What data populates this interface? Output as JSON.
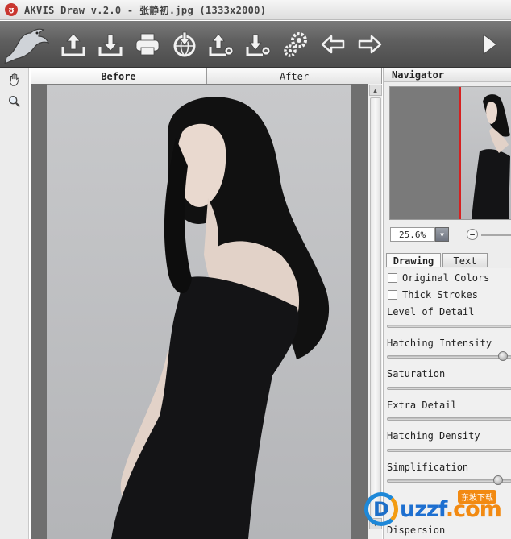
{
  "window": {
    "title": "AKVIS Draw v.2.0 - 张静初.jpg (1333x2000)"
  },
  "toolbar": {
    "buttons": [
      {
        "name": "open",
        "icon": "upload-tray-icon"
      },
      {
        "name": "save",
        "icon": "download-tray-icon"
      },
      {
        "name": "print",
        "icon": "printer-icon"
      },
      {
        "name": "share",
        "icon": "globe-download-icon"
      },
      {
        "name": "load-preset",
        "icon": "upload-gear-icon"
      },
      {
        "name": "save-preset",
        "icon": "download-gear-icon"
      },
      {
        "name": "preferences",
        "icon": "gears-icon"
      },
      {
        "name": "undo",
        "icon": "arrow-left-icon"
      },
      {
        "name": "redo",
        "icon": "arrow-right-icon"
      },
      {
        "name": "run",
        "icon": "play-icon"
      }
    ]
  },
  "view_tabs": {
    "before": "Before",
    "after": "After",
    "active": "before"
  },
  "navigator": {
    "title": "Navigator",
    "zoom": "25.6%",
    "zoom_minus": "−"
  },
  "settings_tabs": {
    "drawing": "Drawing",
    "text": "Text",
    "active": "drawing"
  },
  "settings": {
    "original_colors": {
      "label": "Original Colors",
      "checked": false
    },
    "thick_strokes": {
      "label": "Thick Strokes",
      "checked": false
    },
    "params": [
      {
        "label": "Level of Detail",
        "value": 0.0
      },
      {
        "label": "Hatching Intensity",
        "value": 0.97
      },
      {
        "label": "Saturation",
        "value": 0.0
      },
      {
        "label": "Extra Detail",
        "value": 0.0
      },
      {
        "label": "Hatching Density",
        "value": 0.0
      },
      {
        "label": "Simplification",
        "value": 0.93
      },
      {
        "label": "Dispersion",
        "value": 0.0
      }
    ]
  },
  "watermark": {
    "text_a": "uzzf",
    "text_b": ".com",
    "badge": "东坡下载",
    "circle": "D"
  },
  "colors": {
    "toolbar": "#5e5e5e",
    "accent_red": "#d62020",
    "watermark_blue": "#1e6fc8",
    "watermark_orange": "#f28a12"
  }
}
